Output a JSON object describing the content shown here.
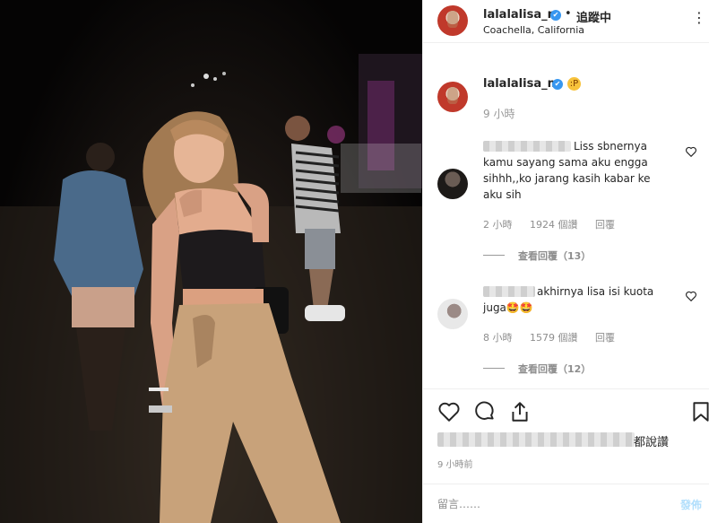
{
  "header": {
    "username": "lalalalisa_m",
    "verified_glyph": "✔",
    "separator": "•",
    "follow_label": "追蹤中",
    "location": "Coachella, California",
    "more_glyph": "⋮"
  },
  "caption": {
    "username": "lalalalisa_m",
    "verified_glyph": "✔",
    "emoji": "😛",
    "time": "9 小時"
  },
  "comments": [
    {
      "text_line1": "Liss sbnernya",
      "text_rest": "kamu sayang sama aku engga sihhh,,ko jarang kasih kabar ke aku sih",
      "time": "2 小時",
      "likes": "1924 個讚",
      "reply_label": "回覆",
      "view_replies": "查看回覆（13）"
    },
    {
      "text_line1": "akhirnya lisa isi kuota",
      "text_rest": "juga🤩🤩",
      "time": "8 小時",
      "likes": "1579 個讚",
      "reply_label": "回覆",
      "view_replies": "查看回覆（12）"
    }
  ],
  "actions": {
    "likes_suffix": "都說讚",
    "post_time": "9 小時前"
  },
  "comment_box": {
    "placeholder": "留言……",
    "post_label": "發佈"
  },
  "colors": {
    "verified": "#3897f0",
    "post_button_disabled": "#b2dffc",
    "muted_text": "#8e8e8e"
  },
  "icons": [
    "verified-icon",
    "more-options-icon",
    "heart-icon",
    "comment-icon",
    "share-icon",
    "bookmark-icon"
  ]
}
